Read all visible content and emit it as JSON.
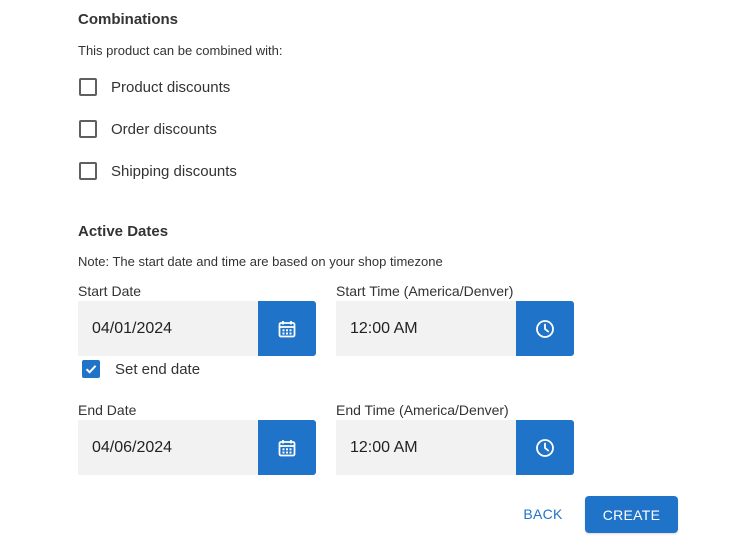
{
  "combinations": {
    "title": "Combinations",
    "description": "This product can be combined with:",
    "options": [
      {
        "label": "Product discounts",
        "checked": false
      },
      {
        "label": "Order discounts",
        "checked": false
      },
      {
        "label": "Shipping discounts",
        "checked": false
      }
    ]
  },
  "active_dates": {
    "title": "Active Dates",
    "note": "Note: The start date and time are based on your shop timezone",
    "start_date": {
      "label": "Start Date",
      "value": "04/01/2024",
      "icon": "calendar-icon"
    },
    "start_time": {
      "label": "Start Time (America/Denver)",
      "value": "12:00 AM",
      "icon": "clock-icon"
    },
    "set_end_date": {
      "label": "Set end date",
      "checked": true
    },
    "end_date": {
      "label": "End Date",
      "value": "04/06/2024",
      "icon": "calendar-icon"
    },
    "end_time": {
      "label": "End Time (America/Denver)",
      "value": "12:00 AM",
      "icon": "clock-icon"
    }
  },
  "actions": {
    "back_label": "BACK",
    "create_label": "CREATE"
  },
  "colors": {
    "accent": "#1f73c9",
    "field_bg": "#f2f2f2"
  }
}
